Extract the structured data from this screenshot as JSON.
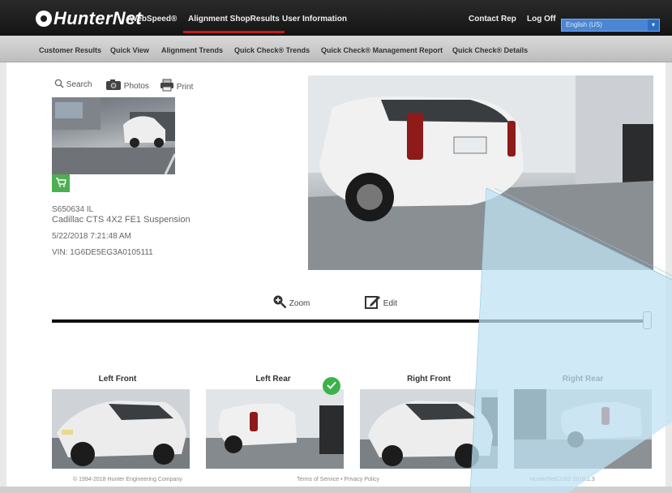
{
  "app": {
    "logo": "HunterNet",
    "nav": [
      "WebSpeed®",
      "Alignment ShopResults",
      "User Information"
    ],
    "nav_active": 1,
    "contact_rep": "Contact Rep",
    "log_off": "Log Off",
    "language": "English (US)"
  },
  "subnav": [
    "Customer Results",
    "Quick View",
    "Alignment Trends",
    "Quick Check® Trends",
    "Quick Check® Management Report",
    "Quick Check® Details"
  ],
  "toolbar": {
    "search": "Search",
    "photos": "Photos",
    "print": "Print"
  },
  "vehicle": {
    "id": "S650634 IL",
    "model": "Cadillac CTS 4X2 FE1 Suspension",
    "datetime": "5/22/2018 7:21:48 AM",
    "vin": "VIN: 1G6DE5EG3A0105111"
  },
  "controls": {
    "zoom": "Zoom",
    "edit": "Edit",
    "slider_value": 1.0
  },
  "views": [
    "Left Front",
    "Left Rear",
    "Right Front",
    "Right Rear"
  ],
  "footer": {
    "copyright": "© 1994-2018 Hunter Engineering Company",
    "links": "Terms of Service • Privacy Policy",
    "version": "HunterNetCUS2 2018.1.3"
  },
  "colors": {
    "accent": "#c21a1a",
    "language_select": "#4a86d4",
    "check_green": "#3bb34a"
  }
}
